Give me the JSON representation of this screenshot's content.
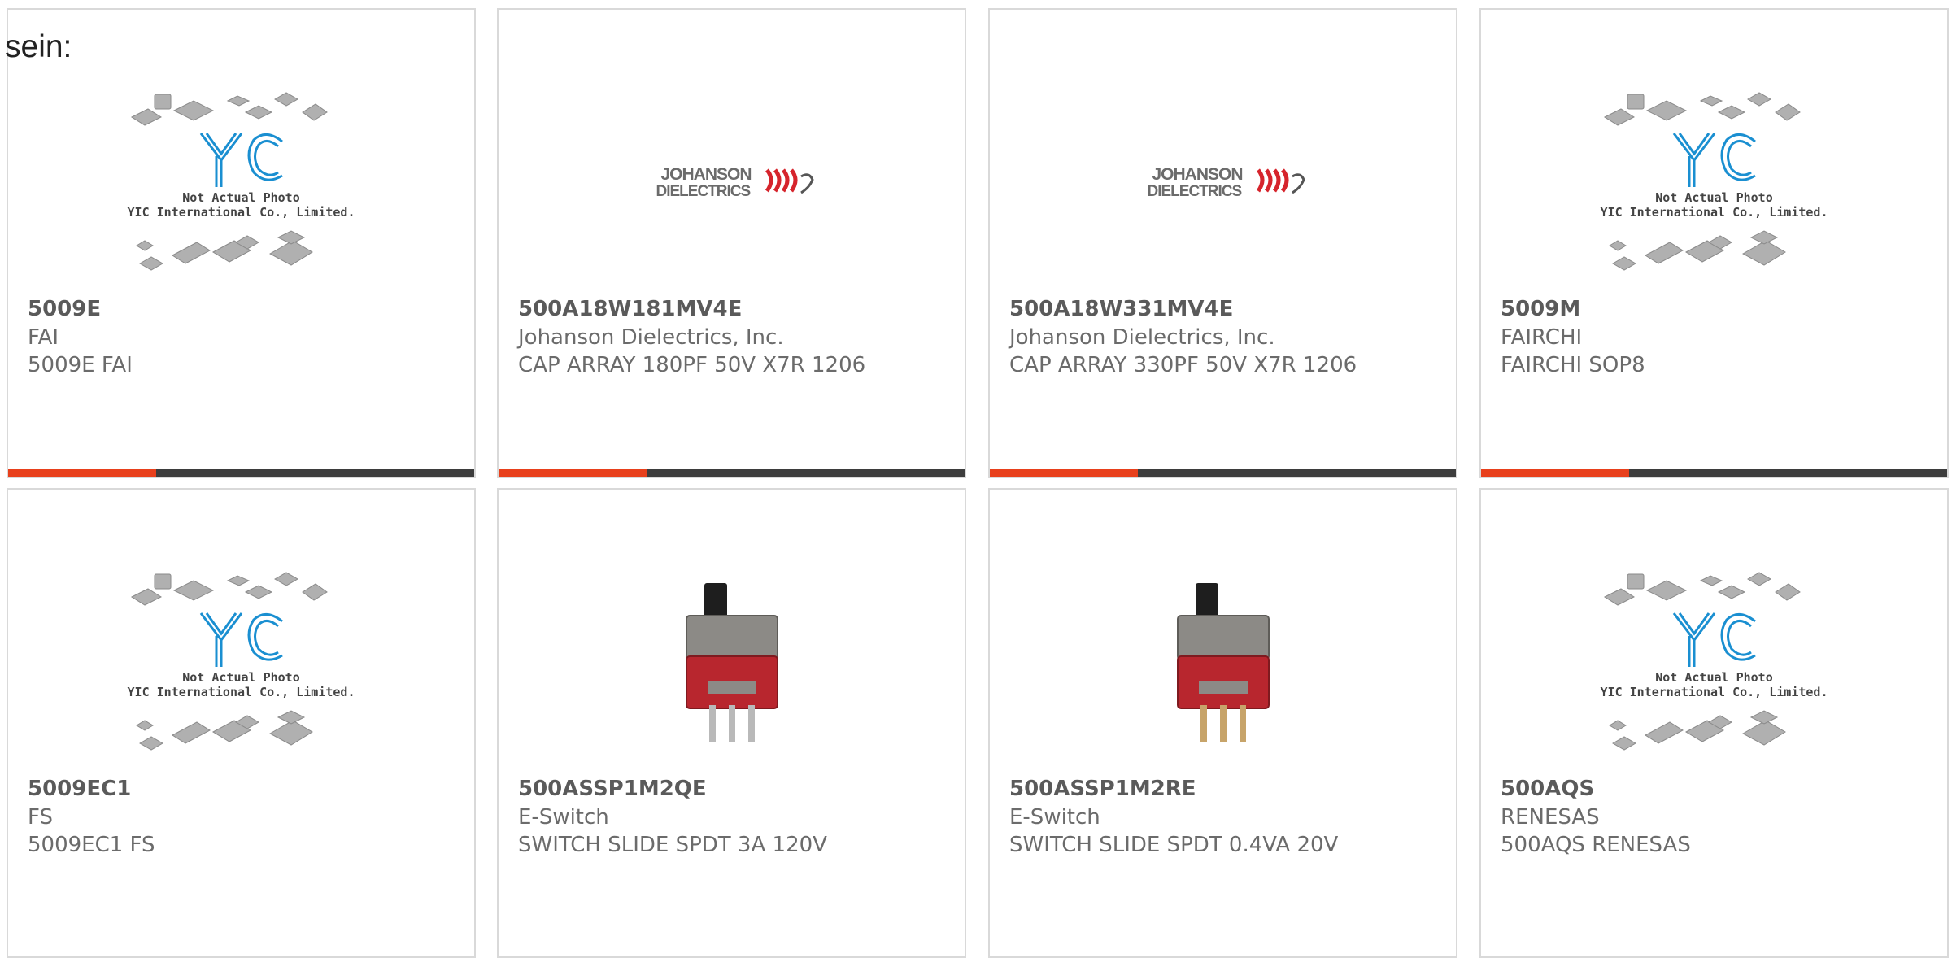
{
  "page_label": "sein:",
  "placeholder": {
    "line1": "Not Actual Photo",
    "line2": "YIC International Co., Limited."
  },
  "logo": {
    "line1": "JOHANSON",
    "line2": "DIELECTRICS"
  },
  "colors": {
    "accent_orange": "#e8401c",
    "accent_dark": "#3d3d3d",
    "border": "#d9d9d9",
    "yic_blue": "#1a8fd1",
    "switch_red": "#b8262e"
  },
  "products": [
    {
      "part": "5009E",
      "maker": "FAI",
      "desc": "5009E FAI",
      "image": "yic-placeholder"
    },
    {
      "part": "500A18W181MV4E",
      "maker": "Johanson Dielectrics, Inc.",
      "desc": "CAP ARRAY 180PF 50V X7R 1206",
      "image": "johanson-logo"
    },
    {
      "part": "500A18W331MV4E",
      "maker": "Johanson Dielectrics, Inc.",
      "desc": "CAP ARRAY 330PF 50V X7R 1206",
      "image": "johanson-logo"
    },
    {
      "part": "5009M",
      "maker": "FAIRCHI",
      "desc": "FAIRCHI SOP8",
      "image": "yic-placeholder"
    },
    {
      "part": "5009EC1",
      "maker": "FS",
      "desc": "5009EC1 FS",
      "image": "yic-placeholder"
    },
    {
      "part": "500ASSP1M2QE",
      "maker": "E-Switch",
      "desc": "SWITCH SLIDE SPDT 3A 120V",
      "image": "slide-switch-photo"
    },
    {
      "part": "500ASSP1M2RE",
      "maker": "E-Switch",
      "desc": "SWITCH SLIDE SPDT 0.4VA 20V",
      "image": "slide-switch-photo"
    },
    {
      "part": "500AQS",
      "maker": "RENESAS",
      "desc": "500AQS RENESAS",
      "image": "yic-placeholder"
    }
  ]
}
